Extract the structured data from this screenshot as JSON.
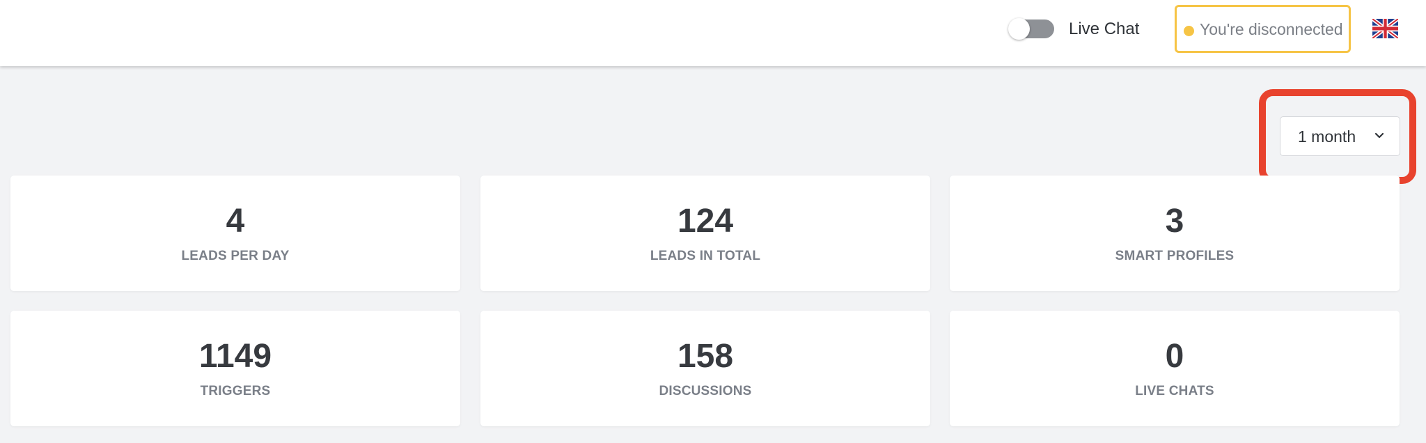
{
  "header": {
    "live_chat_label": "Live Chat",
    "live_chat_enabled": false,
    "connection_status": "You're disconnected",
    "connection_status_color": "#f6c445",
    "language_icon": "uk-flag-icon"
  },
  "filter": {
    "range_value": "1 month",
    "chevron_icon": "chevron-down-icon",
    "highlight_color": "#e8432e"
  },
  "stats": [
    {
      "value": "4",
      "label": "LEADS PER DAY"
    },
    {
      "value": "124",
      "label": "LEADS IN TOTAL"
    },
    {
      "value": "3",
      "label": "SMART PROFILES"
    },
    {
      "value": "1149",
      "label": "TRIGGERS"
    },
    {
      "value": "158",
      "label": "DISCUSSIONS"
    },
    {
      "value": "0",
      "label": "LIVE CHATS"
    }
  ]
}
